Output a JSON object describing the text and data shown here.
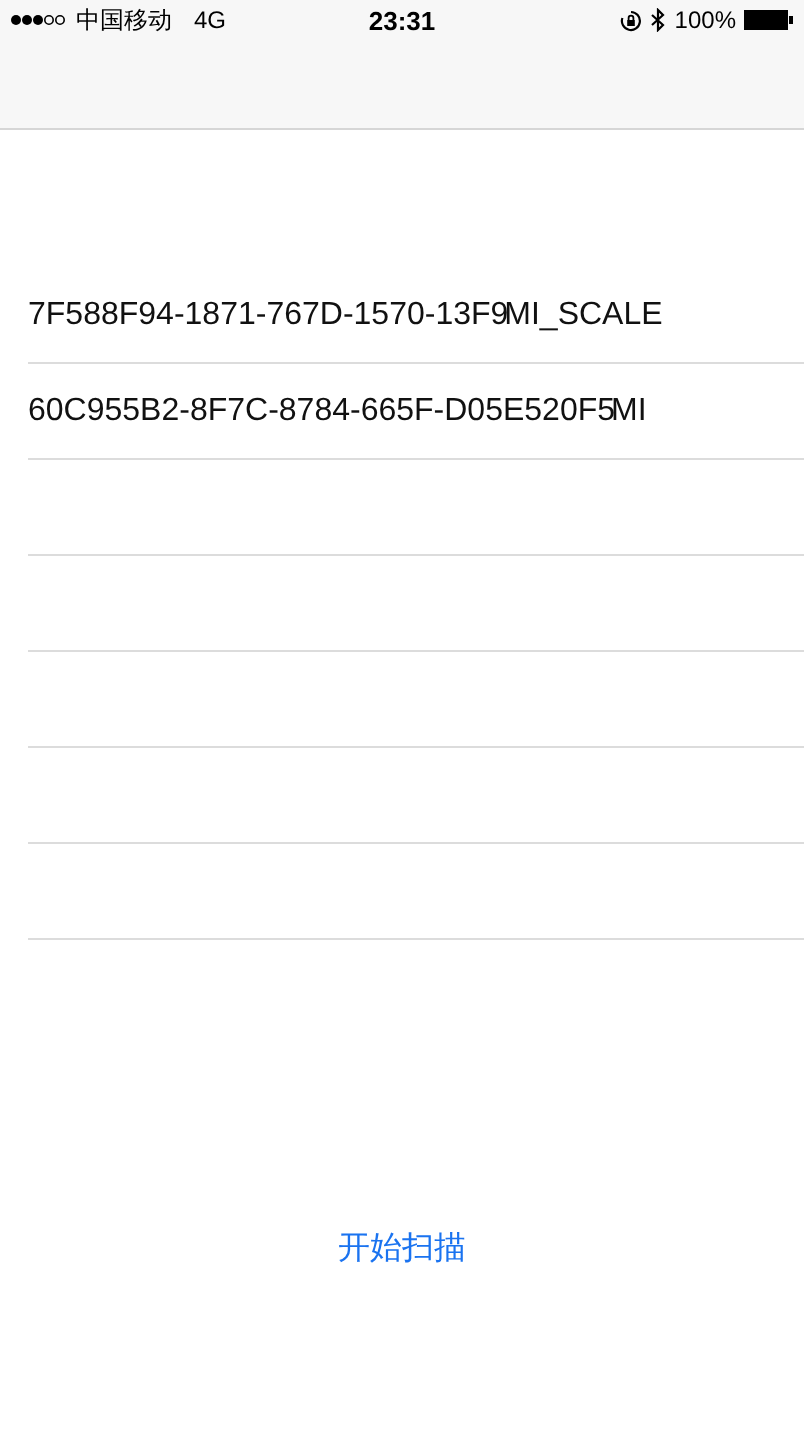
{
  "status_bar": {
    "carrier": "中国移动",
    "network": "4G",
    "time": "23:31",
    "battery": "100%"
  },
  "rows": [
    {
      "uuid": "7F588F94-1871-767D-1570-13F9",
      "name": "MI_SCALE"
    },
    {
      "uuid": "60C955B2-8F7C-8784-665F-D05E520F5",
      "name": "MI"
    },
    {},
    {},
    {},
    {},
    {}
  ],
  "scan_button": "开始扫描"
}
